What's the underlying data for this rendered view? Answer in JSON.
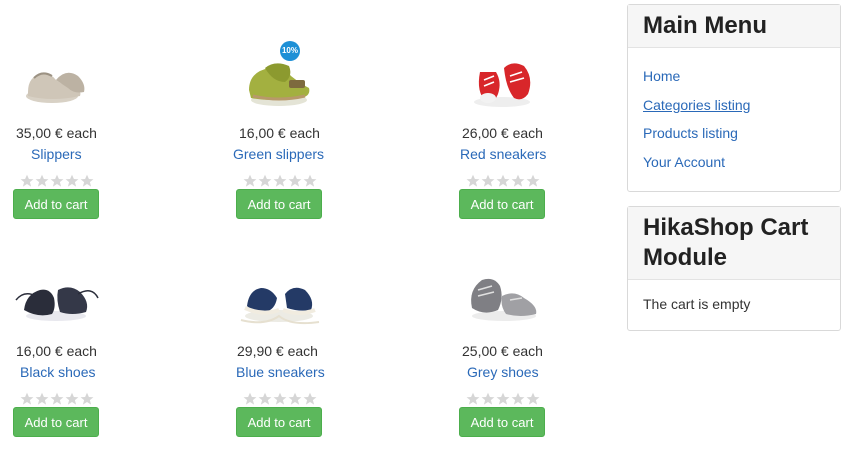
{
  "products": [
    {
      "price": "35,00 € each",
      "name": "Slippers",
      "button": "Add to cart",
      "rating": 0,
      "image_icon": "baby-shoe-slippers-icon"
    },
    {
      "price": "16,00 € each",
      "name": "Green slippers",
      "button": "Add to cart",
      "rating": 0,
      "image_icon": "baby-shoe-green-slippers-icon",
      "badge": "10%"
    },
    {
      "price": "26,00 € each",
      "name": "Red sneakers",
      "button": "Add to cart",
      "rating": 0,
      "image_icon": "baby-shoe-red-sneakers-icon"
    },
    {
      "price": "16,00 € each",
      "name": "Black shoes",
      "button": "Add to cart",
      "rating": 0,
      "image_icon": "baby-shoe-black-shoes-icon"
    },
    {
      "price": "29,90 € each",
      "name": "Blue sneakers",
      "button": "Add to cart",
      "rating": 0,
      "image_icon": "baby-shoe-blue-sneakers-icon"
    },
    {
      "price": "25,00 € each",
      "name": "Grey shoes",
      "button": "Add to cart",
      "rating": 0,
      "image_icon": "baby-shoe-grey-shoes-icon"
    }
  ],
  "main_menu": {
    "title": "Main Menu",
    "items": [
      {
        "label": "Home"
      },
      {
        "label": "Categories listing",
        "active": true
      },
      {
        "label": "Products listing"
      },
      {
        "label": "Your Account"
      }
    ]
  },
  "cart_module": {
    "title": "HikaShop Cart Module",
    "empty_text": "The cart is empty"
  },
  "colors": {
    "link": "#2a69b8",
    "button": "#5cb85c",
    "star_empty": "#d6d6d6",
    "badge": "#1e90d6"
  }
}
